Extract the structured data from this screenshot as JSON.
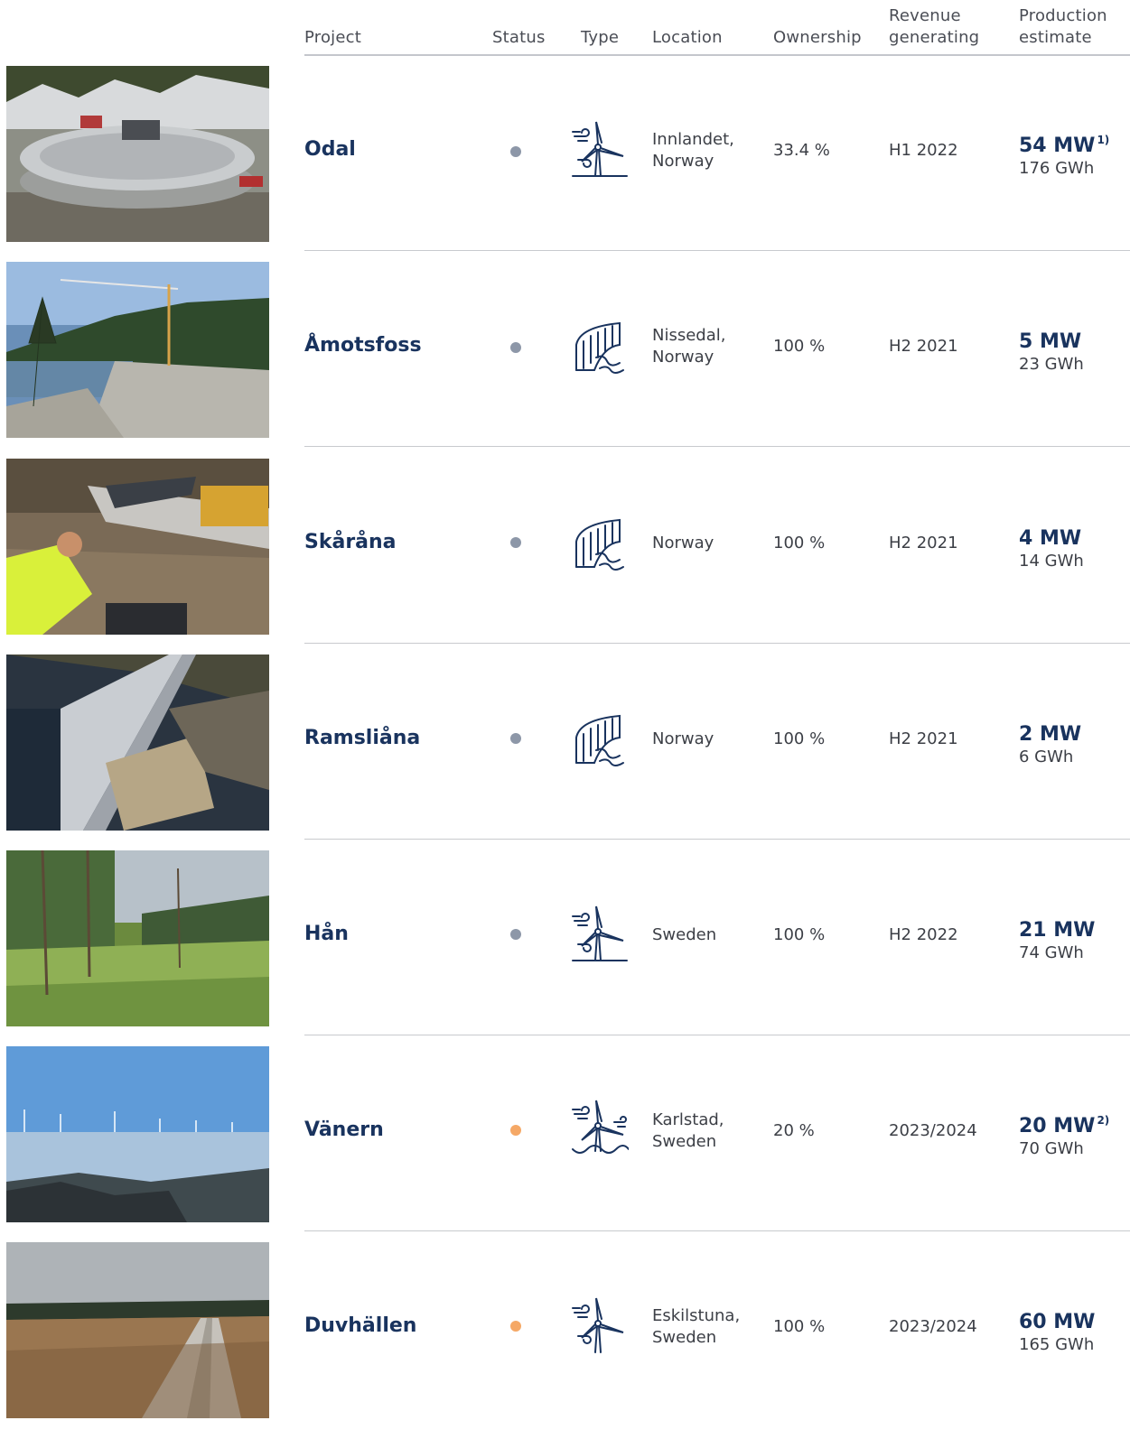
{
  "colors": {
    "navy": "#19335e",
    "status_grey": "#8d97a8",
    "status_orange": "#f5a866",
    "rule": "#c4c6cc"
  },
  "header": {
    "project": "Project",
    "status": "Status",
    "type": "Type",
    "location": "Location",
    "ownership": "Ownership",
    "revenue_line1": "Revenue",
    "revenue_line2": "generating",
    "production_line1": "Production",
    "production_line2": "estimate"
  },
  "rows": [
    {
      "project": "Odal",
      "status": "grey",
      "type_icon": "wind-turbine-icon",
      "location": "Innlandet,\nNorway",
      "ownership": "33.4 %",
      "revenue": "H1 2022",
      "mw": "54 MW",
      "note": "1)",
      "gwh": "176 GWh"
    },
    {
      "project": "Åmotsfoss",
      "status": "grey",
      "type_icon": "hydropower-dam-icon",
      "location": "Nissedal,\nNorway",
      "ownership": "100 %",
      "revenue": "H2 2021",
      "mw": "5 MW",
      "note": "",
      "gwh": "23 GWh"
    },
    {
      "project": "Skåråna",
      "status": "grey",
      "type_icon": "hydropower-dam-icon",
      "location": "Norway",
      "ownership": "100 %",
      "revenue": "H2 2021",
      "mw": "4 MW",
      "note": "",
      "gwh": "14 GWh"
    },
    {
      "project": "Ramsliåna",
      "status": "grey",
      "type_icon": "hydropower-dam-icon",
      "location": "Norway",
      "ownership": "100 %",
      "revenue": "H2 2021",
      "mw": "2 MW",
      "note": "",
      "gwh": "6 GWh"
    },
    {
      "project": "Hån",
      "status": "grey",
      "type_icon": "wind-turbine-icon",
      "location": "Sweden",
      "ownership": "100 %",
      "revenue": "H2 2022",
      "mw": "21 MW",
      "note": "",
      "gwh": "74 GWh"
    },
    {
      "project": "Vänern",
      "status": "orange",
      "type_icon": "offshore-wind-turbine-icon",
      "location": "Karlstad,\nSweden",
      "ownership": "20 %",
      "revenue": "2023/2024",
      "mw": "20 MW",
      "note": "2)",
      "gwh": "70 GWh"
    },
    {
      "project": "Duvhällen",
      "status": "orange",
      "type_icon": "wind-turbine-icon",
      "location": "Eskilstuna,\nSweden",
      "ownership": "100 %",
      "revenue": "2023/2024",
      "mw": "60 MW",
      "note": "",
      "gwh": "165 GWh"
    }
  ]
}
